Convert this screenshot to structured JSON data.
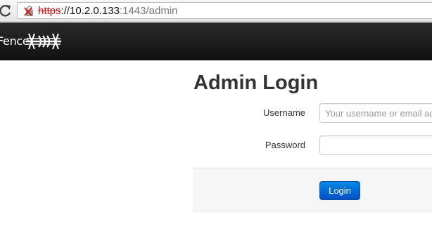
{
  "browser": {
    "url_scheme": "https",
    "url_sep": "://",
    "url_host": "10.2.0.133",
    "url_path": ":1443/admin",
    "reload_icon": "reload-icon",
    "lock_icon": "broken-ssl-lock-icon"
  },
  "navbar": {
    "brand_text": "Fence",
    "logo_icon": "barbed-wire-logo-icon"
  },
  "login": {
    "title": "Admin Login",
    "username_label": "Username",
    "username_placeholder": "Your username or email address",
    "username_value": "",
    "password_label": "Password",
    "password_value": "",
    "login_button": "Login"
  },
  "colors": {
    "navbar_bg": "#1a1a1a",
    "button_primary": "#0066d6",
    "ssl_error": "#c51c1c",
    "form_actions_bg": "#f5f5f5"
  }
}
